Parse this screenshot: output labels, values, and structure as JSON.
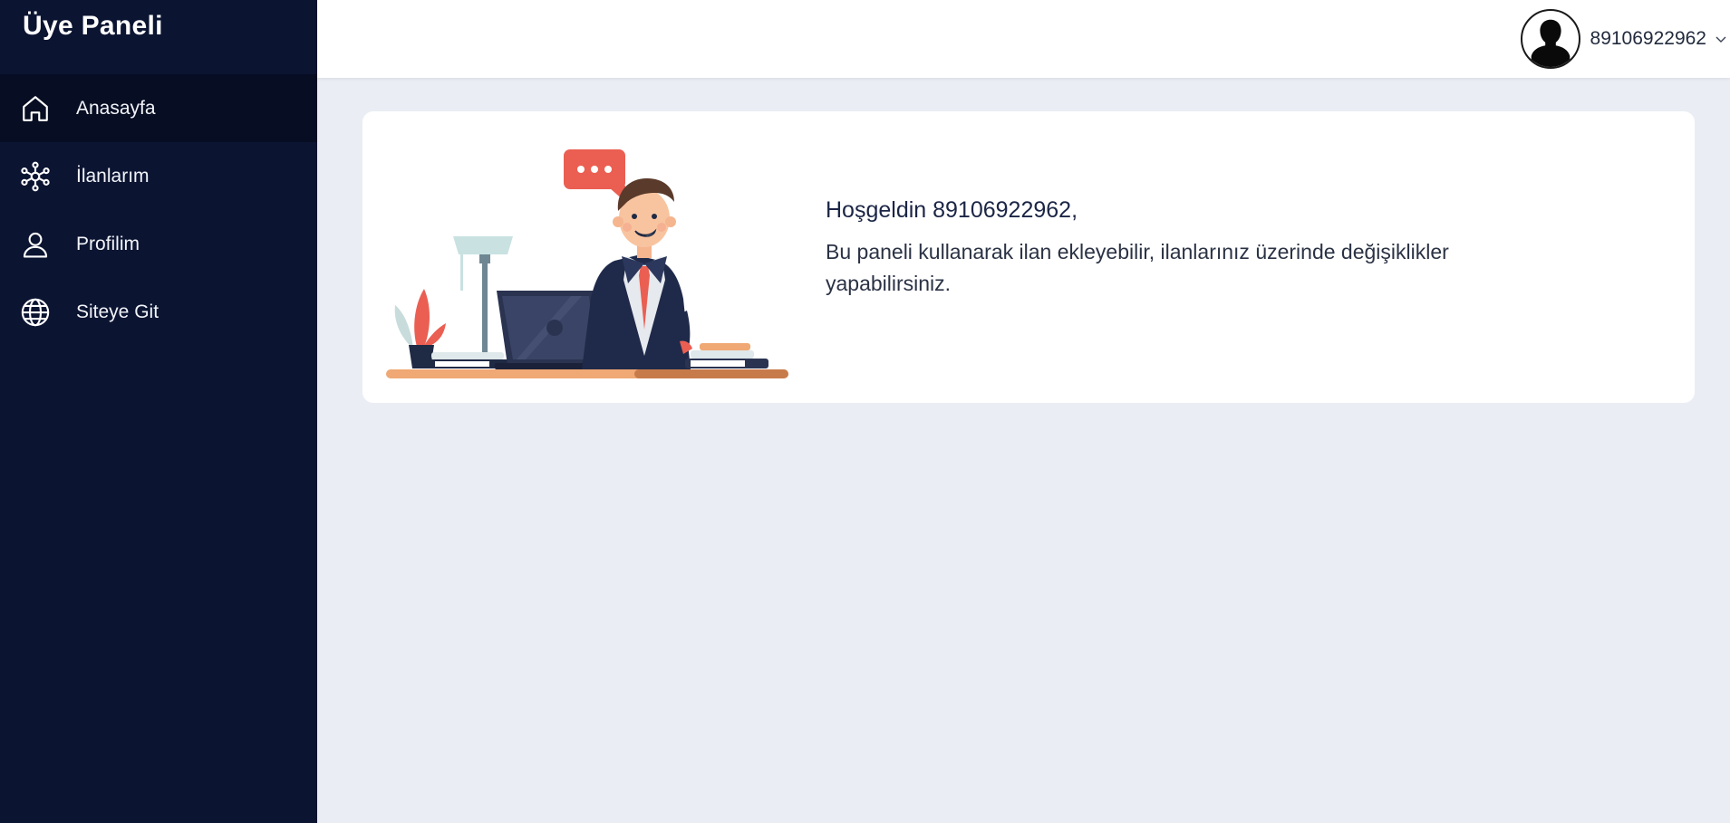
{
  "sidebar": {
    "title": "Üye Paneli",
    "items": [
      {
        "label": "Anasayfa",
        "icon": "home-icon"
      },
      {
        "label": "İlanlarım",
        "icon": "network-icon"
      },
      {
        "label": "Profilim",
        "icon": "user-icon"
      },
      {
        "label": "Siteye Git",
        "icon": "globe-icon"
      }
    ]
  },
  "header": {
    "username": "89106922962",
    "avatar_icon": "user-avatar-icon",
    "dropdown_icon": "chevron-down-icon"
  },
  "welcome": {
    "title": "Hoşgeldin 89106922962,",
    "message": "Bu paneli kullanarak ilan ekleyebilir, ilanlarınız üzerinde değişiklikler yapabilirsiniz."
  },
  "colors": {
    "sidebar_bg": "#0b1431",
    "active_item_bg": "#070d22",
    "page_bg": "#eaeef4",
    "accent_red": "#ea5f52"
  }
}
